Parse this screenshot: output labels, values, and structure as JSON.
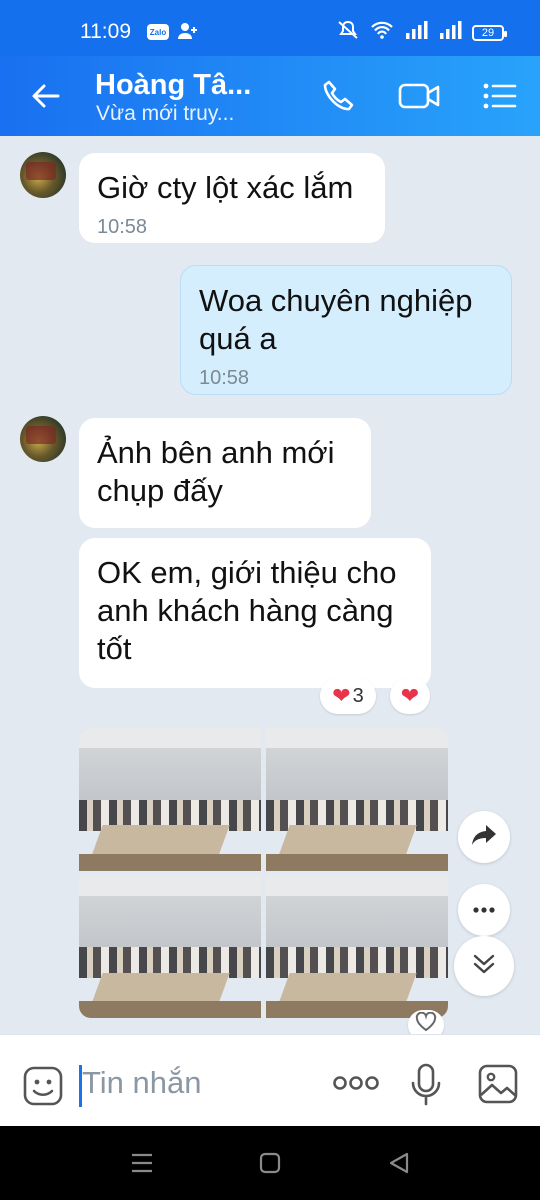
{
  "status_bar": {
    "time": "11:09",
    "zalo_badge": "Zalo",
    "battery": "29"
  },
  "header": {
    "title": "Hoàng Tâ...",
    "subtitle": "Vừa mới truy..."
  },
  "messages": [
    {
      "direction": "in",
      "text": "Giờ cty lột xác lắm",
      "time": "10:58"
    },
    {
      "direction": "out",
      "lines": [
        "Woa chuyên nghiệp",
        "quá a"
      ],
      "time": "10:58"
    },
    {
      "direction": "in",
      "lines": [
        "Ảnh bên anh mới",
        "chụp đấy"
      ]
    },
    {
      "direction": "in",
      "lines": [
        "OK em, giới thiệu cho",
        "anh khách hàng càng",
        "tốt"
      ]
    }
  ],
  "reactions": {
    "heart_count": "3"
  },
  "photos": [
    "photo-meeting-1",
    "photo-meeting-2",
    "photo-meeting-3",
    "photo-meeting-4"
  ],
  "input": {
    "placeholder": "Tin nhắn"
  },
  "colors": {
    "header_start": "#1970f0",
    "header_end": "#28a3fb",
    "bg": "#e2e9f1",
    "out_bubble": "#d5eefe",
    "heart": "#e8344a"
  }
}
